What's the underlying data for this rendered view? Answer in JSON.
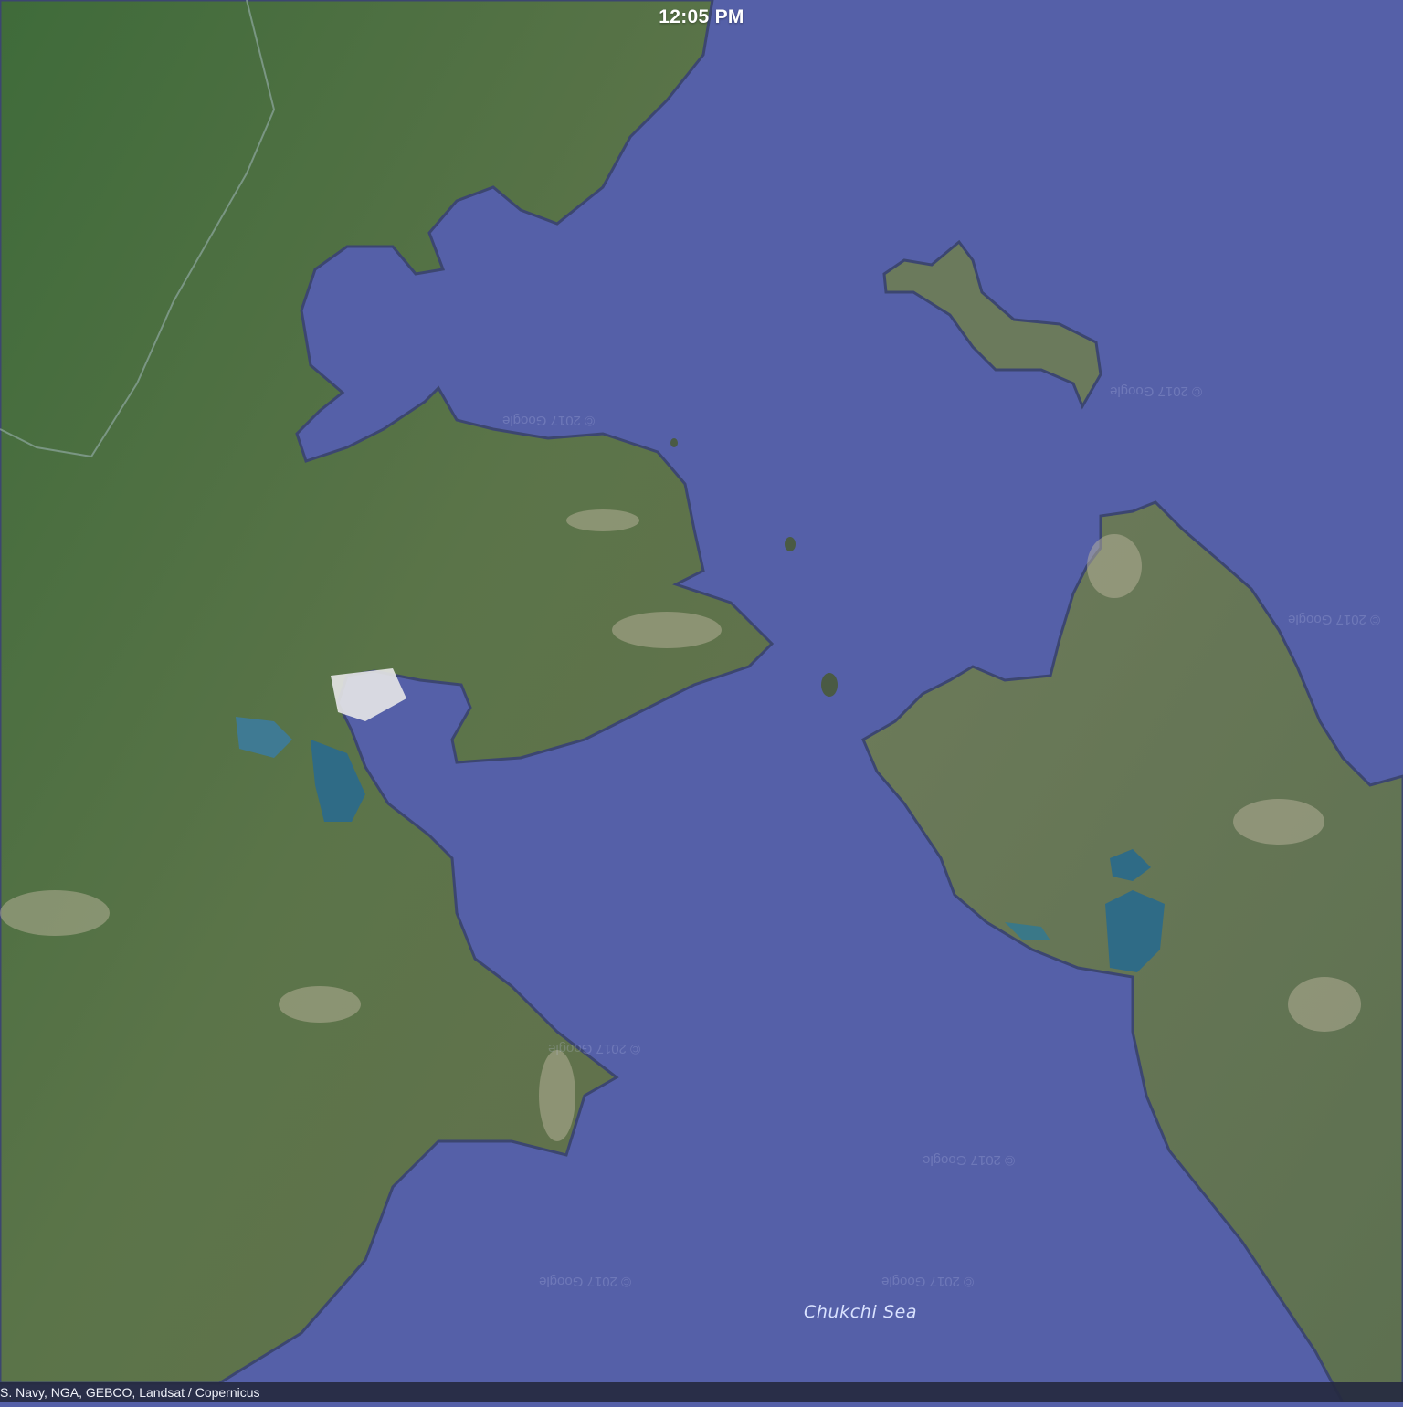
{
  "status_bar": {
    "time": "12:05 PM"
  },
  "map": {
    "sea_label": "Chukchi Sea",
    "watermark": "© 2017 Google",
    "attribution": "S. Navy, NGA, GEBCO, Landsat / Copernicus",
    "colors": {
      "water": "#5560a8",
      "land": "#56714a",
      "land_dark": "#3f5f3a",
      "coast": "#3c4670"
    }
  }
}
